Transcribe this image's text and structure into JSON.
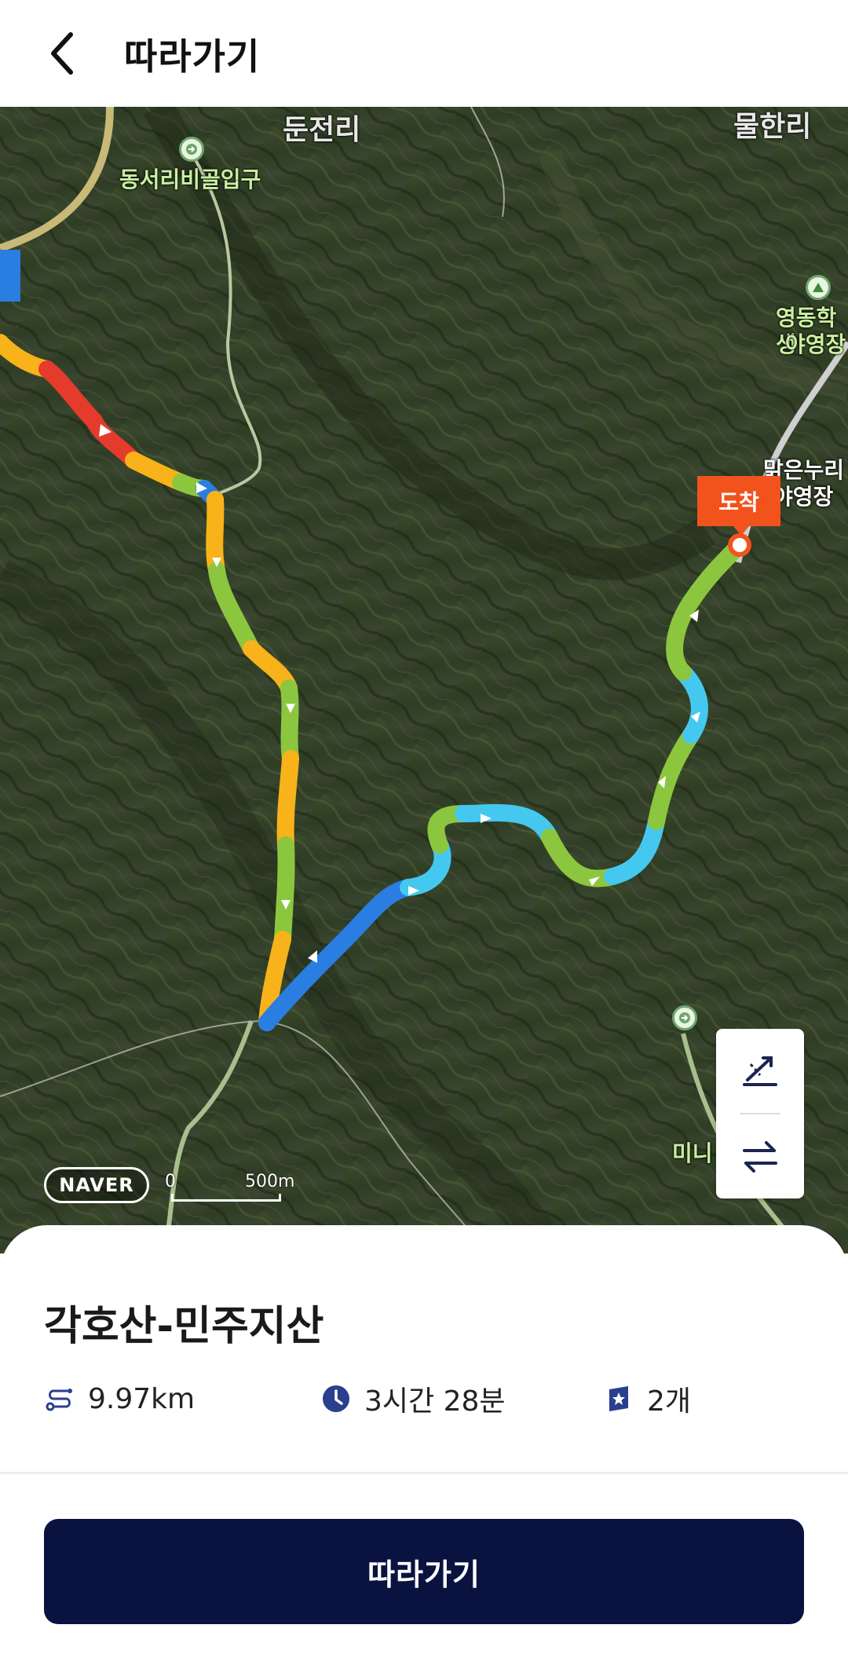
{
  "header": {
    "title": "따라가기",
    "back_icon": "chevron-left-icon"
  },
  "map": {
    "labels": {
      "village_left": "둔전리",
      "village_right": "물한리",
      "poi_entrance": "동서리비골입구",
      "poi_campsite_1a": "영동학생",
      "poi_campsite_1b": "야영장",
      "poi_campsite_2a": "맑은누리",
      "poi_campsite_2b": "야영장",
      "poi_bottom": "미니"
    },
    "arrival_badge": "도착",
    "logo": "NAVER",
    "scale": {
      "start": "0",
      "distance": "500m"
    },
    "route_colors": {
      "slowest": "#e53b2c",
      "slow": "#f8b21a",
      "medium": "#8cc63f",
      "fast": "#45c8f0",
      "fastest": "#2a7de1"
    },
    "controls": [
      {
        "icon": "elevation-chart-icon"
      },
      {
        "icon": "reverse-route-icon"
      }
    ]
  },
  "course": {
    "name": "각호산-민주지산",
    "distance": "9.97km",
    "duration": "3시간 28분",
    "stamps": "2개",
    "accent_color": "#2b3f8f"
  },
  "action": {
    "follow_label": "따라가기",
    "color": "#0a1240"
  }
}
